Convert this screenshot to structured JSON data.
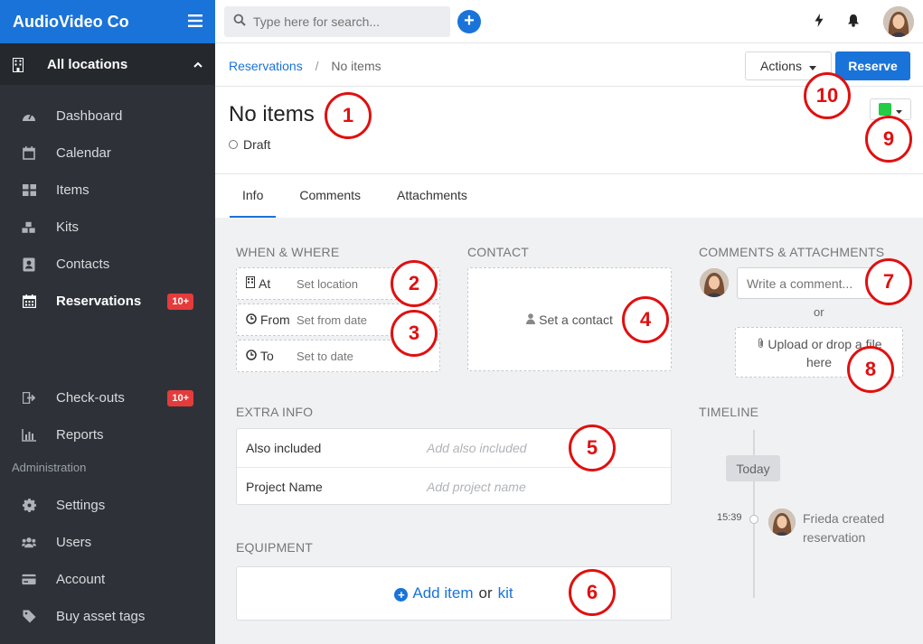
{
  "app": {
    "brand": "AudioVideo Co"
  },
  "sidebar": {
    "location": "All locations",
    "items": [
      {
        "label": "Dashboard",
        "icon": "dashboard-icon"
      },
      {
        "label": "Calendar",
        "icon": "calendar-icon"
      },
      {
        "label": "Items",
        "icon": "items-icon"
      },
      {
        "label": "Kits",
        "icon": "kits-icon"
      },
      {
        "label": "Contacts",
        "icon": "contacts-icon"
      },
      {
        "label": "Reservations",
        "icon": "calendar-grid-icon",
        "badge": "10+"
      }
    ],
    "items2": [
      {
        "label": "Check-outs",
        "icon": "checkout-icon",
        "badge": "10+"
      },
      {
        "label": "Reports",
        "icon": "reports-icon"
      }
    ],
    "admin_label": "Administration",
    "admin_items": [
      {
        "label": "Settings",
        "icon": "gear-icon"
      },
      {
        "label": "Users",
        "icon": "users-icon"
      },
      {
        "label": "Account",
        "icon": "credit-card-icon"
      },
      {
        "label": "Buy asset tags",
        "icon": "tag-icon"
      }
    ]
  },
  "topbar": {
    "search_placeholder": "Type here for search..."
  },
  "breadcrumb": {
    "parent": "Reservations",
    "sep": "/",
    "current": "No items"
  },
  "header": {
    "actions_label": "Actions",
    "reserve_label": "Reserve",
    "title": "No items",
    "status": "Draft",
    "color": "#22cc44"
  },
  "tabs": [
    "Info",
    "Comments",
    "Attachments"
  ],
  "when_where": {
    "title": "WHEN & WHERE",
    "at_label": "At",
    "at_value": "Set location",
    "from_label": "From",
    "from_value": "Set from date",
    "to_label": "To",
    "to_value": "Set to date"
  },
  "contact": {
    "title": "CONTACT",
    "placeholder": "Set a contact"
  },
  "comments": {
    "title": "COMMENTS & ATTACHMENTS",
    "placeholder": "Write a comment...",
    "or": "or",
    "upload_line1": "Upload or drop a file",
    "upload_line2": "here"
  },
  "extra": {
    "title": "EXTRA INFO",
    "rows": [
      {
        "key": "Also included",
        "placeholder": "Add also included"
      },
      {
        "key": "Project Name",
        "placeholder": "Add project name"
      }
    ]
  },
  "equipment": {
    "title": "EQUIPMENT",
    "add_item": "Add item",
    "or": "or",
    "kit": "kit"
  },
  "timeline": {
    "title": "TIMELINE",
    "today": "Today",
    "time": "15:39",
    "text": "Frieda created reservation"
  },
  "callouts": [
    "1",
    "2",
    "3",
    "4",
    "5",
    "6",
    "7",
    "8",
    "9",
    "10"
  ]
}
